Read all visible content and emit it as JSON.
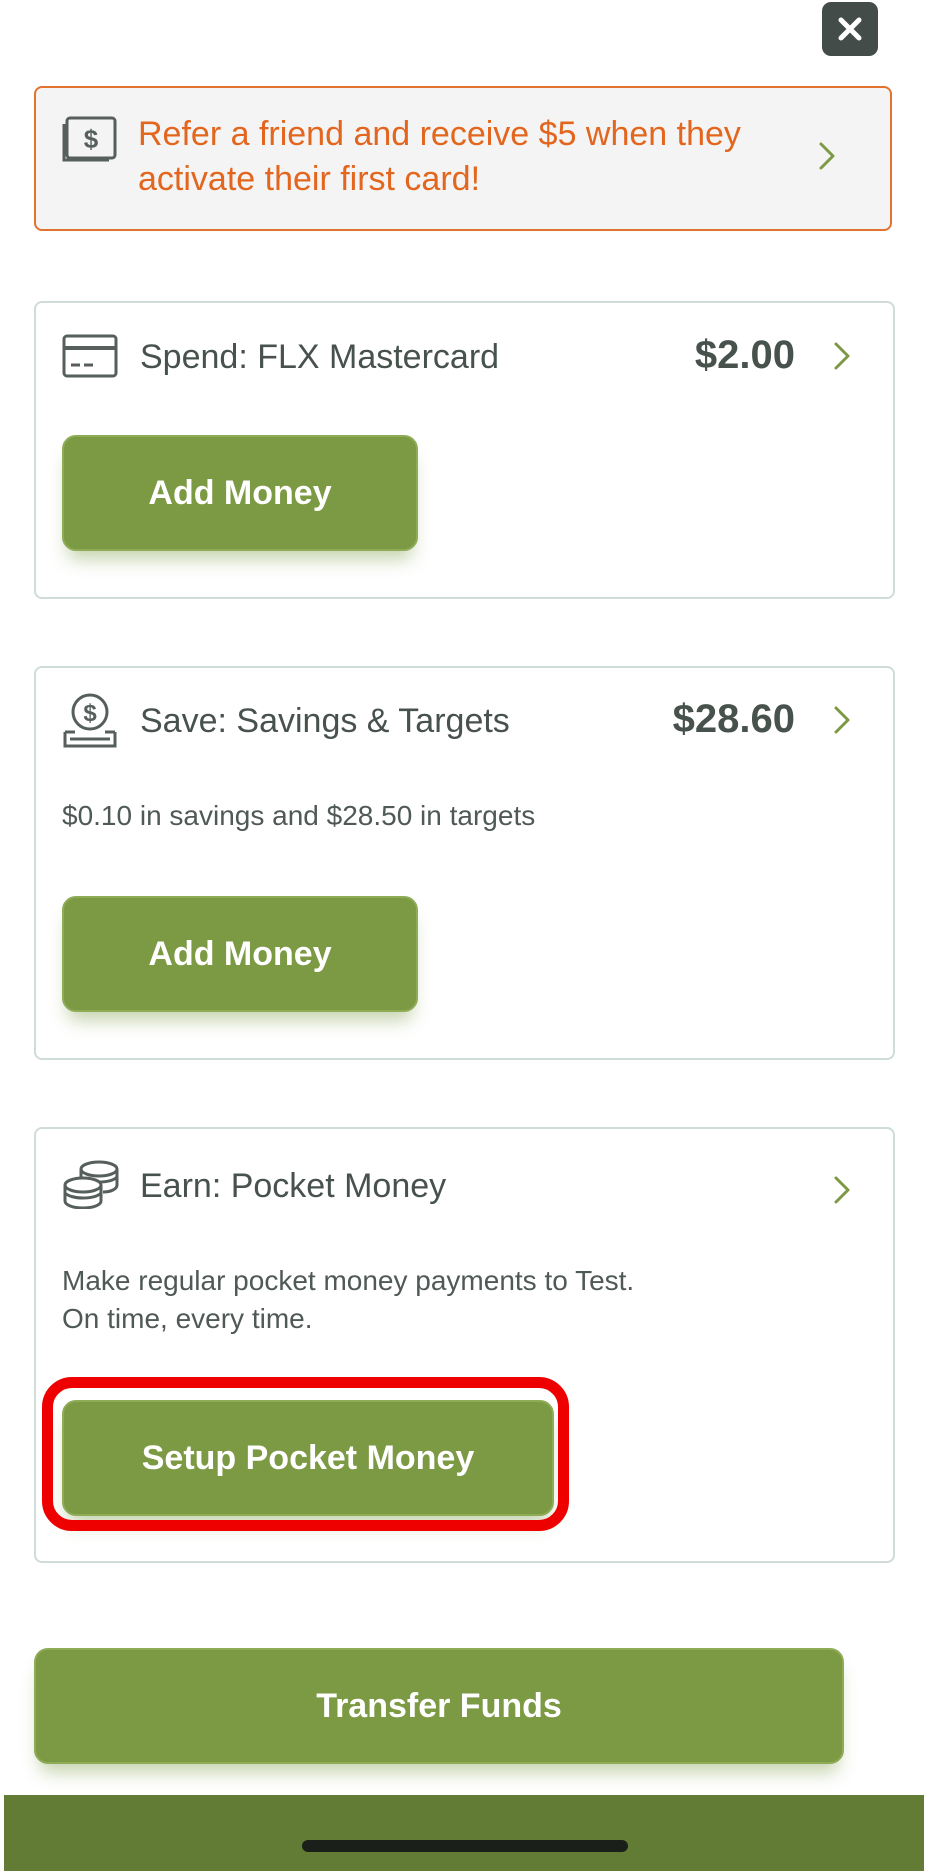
{
  "close_button": {
    "icon": "close-icon"
  },
  "referral": {
    "icon": "dollar-bill-icon",
    "text": "Refer a friend and receive $5 when they activate their first card!"
  },
  "accounts": {
    "spend": {
      "icon": "credit-card-icon",
      "title": "Spend: FLX Mastercard",
      "amount": "$2.00",
      "button_label": "Add Money"
    },
    "save": {
      "icon": "savings-bank-icon",
      "title": "Save: Savings & Targets",
      "amount": "$28.60",
      "description": "$0.10 in savings and $28.50 in targets",
      "button_label": "Add Money"
    },
    "earn": {
      "icon": "coin-stack-icon",
      "title": "Earn: Pocket Money",
      "description_line1": "Make regular pocket money payments to Test.",
      "description_line2": "On time, every time.",
      "button_label": "Setup Pocket Money"
    }
  },
  "transfer_button_label": "Transfer Funds",
  "colors": {
    "brand_green": "#7c9944",
    "dark_green_bar": "#627c36",
    "referral_orange": "#e3661e",
    "highlight_red": "#ee0000",
    "text_dark": "#48524d"
  }
}
